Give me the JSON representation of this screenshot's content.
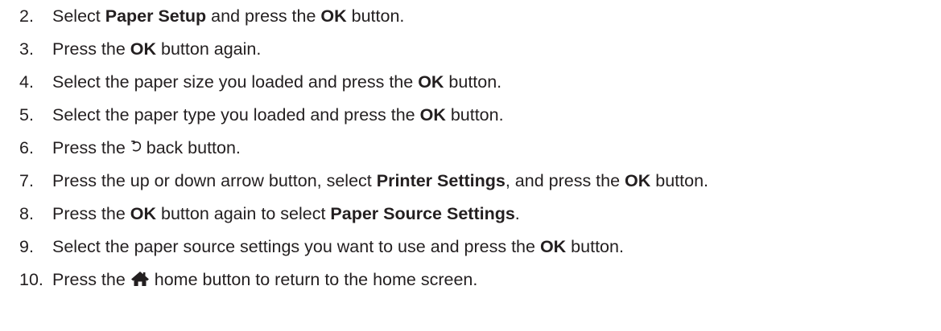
{
  "steps": [
    {
      "num": "2.",
      "parts": [
        "Select ",
        "Paper Setup",
        " and press the ",
        "OK",
        " button."
      ]
    },
    {
      "num": "3.",
      "parts": [
        "Press the ",
        "OK",
        " button again."
      ]
    },
    {
      "num": "4.",
      "parts": [
        "Select the paper size you loaded and press the ",
        "OK",
        " button."
      ]
    },
    {
      "num": "5.",
      "parts": [
        "Select the paper type you loaded and press the ",
        "OK",
        " button."
      ]
    },
    {
      "num": "6.",
      "parts": [
        "Press the ",
        " back button."
      ],
      "icon": "back-arrow-icon"
    },
    {
      "num": "7.",
      "parts": [
        "Press the up or down arrow button, select ",
        "Printer Settings",
        ", and press the ",
        "OK",
        " button."
      ]
    },
    {
      "num": "8.",
      "parts": [
        "Press the ",
        "OK",
        " button again to select ",
        "Paper Source Settings",
        "."
      ]
    },
    {
      "num": "9.",
      "parts": [
        "Select the paper source settings you want to use and press the ",
        "OK",
        " button."
      ]
    },
    {
      "num": "10.",
      "parts": [
        "Press the ",
        " home button to return to the home screen."
      ],
      "icon": "home-icon"
    }
  ]
}
